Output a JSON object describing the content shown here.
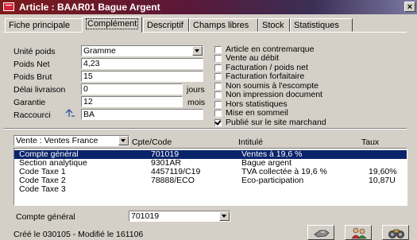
{
  "window": {
    "title": "Article : BAAR01 Bague Argent",
    "close_label": "×"
  },
  "tabs": [
    {
      "label": "Fiche principale",
      "active": false
    },
    {
      "label": "Complément",
      "active": true
    },
    {
      "label": "Descriptif",
      "active": false
    },
    {
      "label": "Champs libres",
      "active": false
    },
    {
      "label": "Stock",
      "active": false
    },
    {
      "label": "Statistiques",
      "active": false
    }
  ],
  "form": {
    "unite_poids": {
      "label": "Unité poids",
      "value": "Gramme"
    },
    "poids_net": {
      "label": "Poids Net",
      "value": "4,23"
    },
    "poids_brut": {
      "label": "Poids Brut",
      "value": "15"
    },
    "delai_livraison": {
      "label": "Délai livraison",
      "value": "0",
      "unit": "jours"
    },
    "garantie": {
      "label": "Garantie",
      "value": "12",
      "unit": "mois"
    },
    "raccourci": {
      "label": "Raccourci",
      "value": "BA"
    }
  },
  "options": [
    {
      "label": "Article en contremarque",
      "checked": false
    },
    {
      "label": "Vente au débit",
      "checked": false
    },
    {
      "label": "Facturation / poids net",
      "checked": false
    },
    {
      "label": "Facturation forfaitaire",
      "checked": false
    },
    {
      "label": "Non soumis à l'escompte",
      "checked": false
    },
    {
      "label": "Non impression document",
      "checked": false
    },
    {
      "label": "Hors statistiques",
      "checked": false
    },
    {
      "label": "Mise en sommeil",
      "checked": false
    },
    {
      "label": "Publié sur le site marchand",
      "checked": true
    }
  ],
  "accounting": {
    "sales_select": "Vente : Ventes France",
    "headers": {
      "code": "Cpte/Code",
      "label": "Intitulé",
      "rate": "Taux"
    },
    "rows": [
      {
        "name": "Compte général",
        "code": "701019",
        "label": "Ventes à 19,6 %",
        "rate": "",
        "selected": true
      },
      {
        "name": "Section analytique",
        "code": "9301AR",
        "label": "Bague argent",
        "rate": "",
        "selected": false
      },
      {
        "name": "Code Taxe 1",
        "code": "4457119/C19",
        "label": "TVA collectée à 19,6 %",
        "rate": "19,60%",
        "selected": false
      },
      {
        "name": "Code Taxe 2",
        "code": "78888/ECO",
        "label": "Eco-participation",
        "rate": "10,87U",
        "selected": false
      },
      {
        "name": "Code Taxe 3",
        "code": "",
        "label": "",
        "rate": "",
        "selected": false
      }
    ]
  },
  "bottom": {
    "compte_label": "Compte général",
    "compte_value": "701019",
    "status": "Créé le 030105 - Modifié le 161106"
  },
  "toolbar_icons": [
    "cancel-icon",
    "users-icon",
    "binoculars-icon"
  ],
  "colors": {
    "selection": "#0a246a",
    "titlebar": "#7b1a1a"
  }
}
